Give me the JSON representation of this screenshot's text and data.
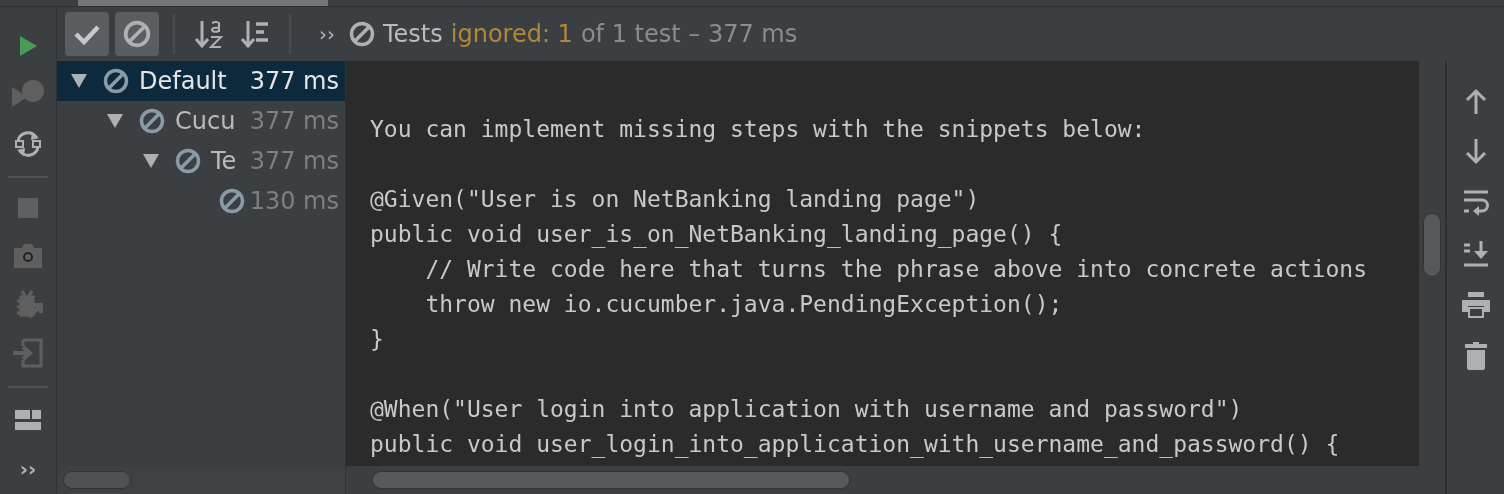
{
  "left_toolbar": [
    {
      "kind": "run",
      "disabled": false
    },
    {
      "kind": "rerun-failed",
      "disabled": true
    },
    {
      "kind": "auto-test",
      "disabled": false
    },
    {
      "kind": "separator"
    },
    {
      "kind": "stop",
      "disabled": true
    },
    {
      "kind": "camera",
      "disabled": true
    },
    {
      "kind": "bug",
      "disabled": true
    },
    {
      "kind": "import",
      "disabled": true
    },
    {
      "kind": "separator"
    },
    {
      "kind": "layout",
      "disabled": false
    },
    {
      "kind": "more",
      "text": "››"
    }
  ],
  "top_toolbar": {
    "toggles": [
      {
        "kind": "check",
        "selected": true
      },
      {
        "kind": "ignored",
        "selected": true
      }
    ],
    "sort_buttons": [
      {
        "kind": "sort-alpha"
      },
      {
        "kind": "sort-duration"
      }
    ],
    "more": "››",
    "status": {
      "title": "Tests",
      "ignored": "ignored: 1",
      "summary": "of 1 test – 377 ms"
    }
  },
  "tree": [
    {
      "name": "Default",
      "time": "377 ms",
      "selected": true,
      "expanded": true,
      "children": [
        {
          "name": "Cucu",
          "time": "377 ms",
          "selected": false,
          "expanded": true,
          "children": [
            {
              "name": "Te",
              "time": "377 ms",
              "selected": false,
              "expanded": true,
              "children": [
                {
                  "time": "130 ms",
                  "selected": false
                }
              ]
            }
          ]
        }
      ]
    }
  ],
  "console": {
    "lines": [
      {
        "kind": "blank"
      },
      {
        "kind": "text",
        "text": "You can implement missing steps with the snippets below:"
      },
      {
        "kind": "blank"
      },
      {
        "kind": "text",
        "text": "@Given(\"User is on NetBanking landing page\")"
      },
      {
        "kind": "text",
        "text": "public void user_is_on_NetBanking_landing_page() {"
      },
      {
        "kind": "text",
        "text": "    // Write code here that turns the phrase above into concrete actions"
      },
      {
        "kind": "text",
        "text": "    throw new io.cucumber.java.PendingException();"
      },
      {
        "kind": "text",
        "text": "}"
      },
      {
        "kind": "blank"
      },
      {
        "kind": "text",
        "text": "@When(\"User login into application with username and password\")"
      },
      {
        "kind": "text",
        "text": "public void user_login_into_application_with_username_and_password() {"
      }
    ]
  },
  "right_toolbar": [
    {
      "kind": "up"
    },
    {
      "kind": "down"
    },
    {
      "kind": "wrap"
    },
    {
      "kind": "scroll-end"
    },
    {
      "kind": "print"
    },
    {
      "kind": "trash"
    }
  ]
}
